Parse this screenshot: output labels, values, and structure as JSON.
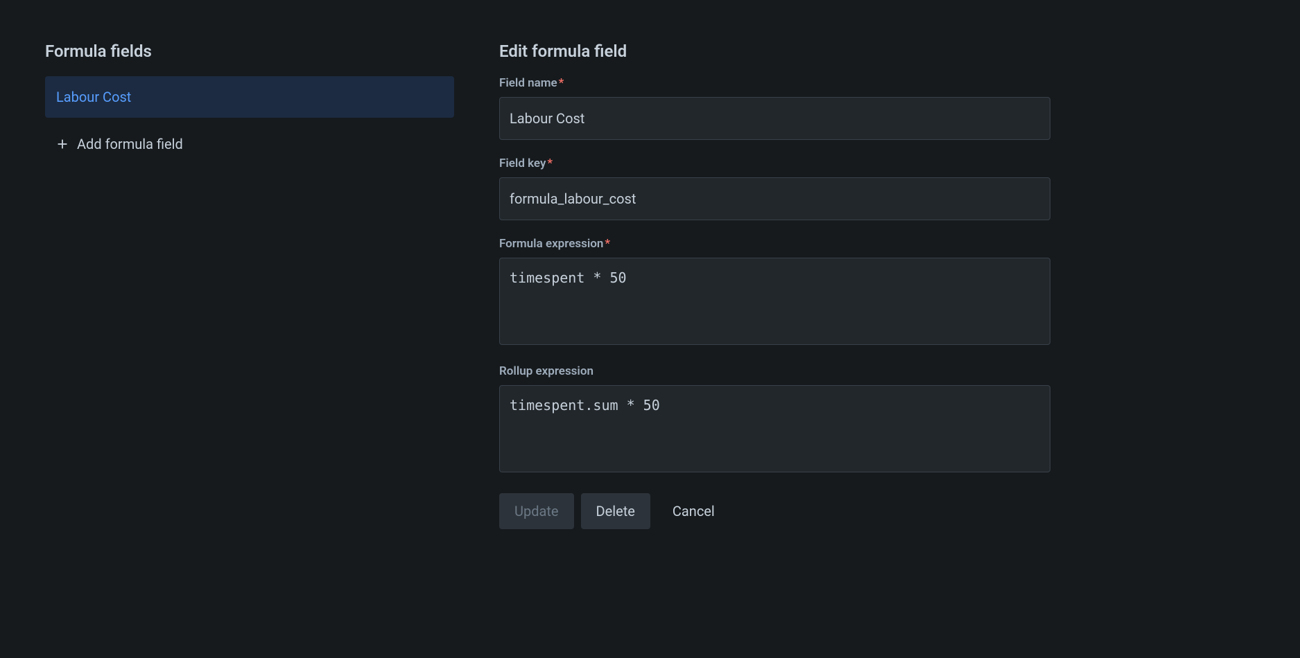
{
  "sidebar": {
    "title": "Formula fields",
    "items": [
      {
        "label": "Labour Cost"
      }
    ],
    "add_label": "Add formula field"
  },
  "editor": {
    "title": "Edit formula field",
    "field_name": {
      "label": "Field name",
      "value": "Labour Cost",
      "required": true
    },
    "field_key": {
      "label": "Field key",
      "value": "formula_labour_cost",
      "required": true
    },
    "formula_expression": {
      "label": "Formula expression",
      "value": "timespent * 50",
      "required": true
    },
    "rollup_expression": {
      "label": "Rollup expression",
      "value": "timespent.sum * 50",
      "required": false
    },
    "buttons": {
      "update": "Update",
      "delete": "Delete",
      "cancel": "Cancel"
    }
  }
}
